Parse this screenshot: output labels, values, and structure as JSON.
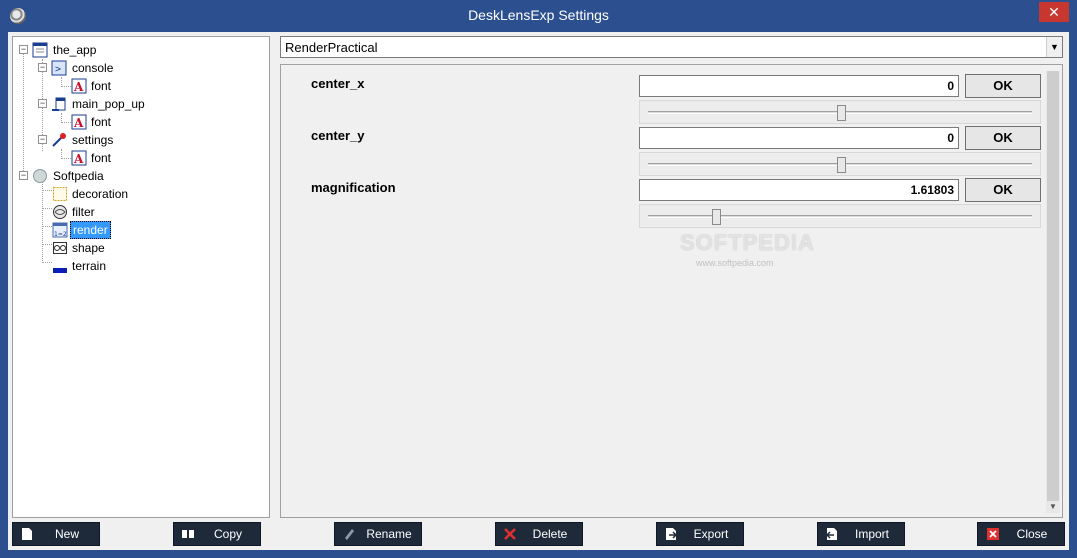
{
  "window": {
    "title": "DeskLensExp Settings",
    "close_glyph": "✕"
  },
  "tree": {
    "nodes": [
      {
        "label": "the_app",
        "icon": "window-icon"
      },
      {
        "label": "console",
        "icon": "console-icon"
      },
      {
        "label": "font",
        "icon": "font-icon"
      },
      {
        "label": "main_pop_up",
        "icon": "popup-icon"
      },
      {
        "label": "font",
        "icon": "font-icon"
      },
      {
        "label": "settings",
        "icon": "wrench-icon"
      },
      {
        "label": "font",
        "icon": "font-icon"
      },
      {
        "label": "Softpedia",
        "icon": "lens-icon"
      },
      {
        "label": "decoration",
        "icon": "decoration-icon"
      },
      {
        "label": "filter",
        "icon": "filter-icon"
      },
      {
        "label": "render",
        "icon": "render-icon",
        "selected": true
      },
      {
        "label": "shape",
        "icon": "shape-icon"
      },
      {
        "label": "terrain",
        "icon": "terrain-icon"
      }
    ]
  },
  "combo": {
    "value": "RenderPractical"
  },
  "properties": [
    {
      "name": "center_x",
      "value": "0",
      "ok": "OK",
      "slider_fraction": 0.5
    },
    {
      "name": "center_y",
      "value": "0",
      "ok": "OK",
      "slider_fraction": 0.5
    },
    {
      "name": "magnification",
      "value": "1.61803",
      "ok": "OK",
      "slider_fraction": 0.17
    }
  ],
  "buttons": {
    "new": "New",
    "copy": "Copy",
    "rename": "Rename",
    "delete": "Delete",
    "export": "Export",
    "import": "Import",
    "close": "Close"
  },
  "watermark": {
    "main": "SOFTPEDIA",
    "sub": "www.softpedia.com"
  },
  "colors": {
    "titlebar": "#2b4f8f",
    "selection": "#3399ff",
    "button_bg": "#1e2a3a",
    "close_red": "#c7372f"
  }
}
